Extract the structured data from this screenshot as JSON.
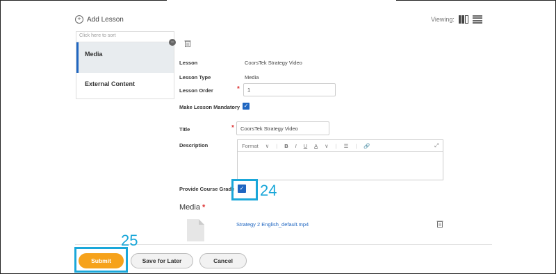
{
  "header": {
    "add_lesson": "Add Lesson",
    "viewing": "Viewing:"
  },
  "sidebar": {
    "sort_hint": "Click here to sort",
    "items": [
      {
        "label": "Media",
        "active": true
      },
      {
        "label": "External Content",
        "active": false
      }
    ]
  },
  "form": {
    "lesson_label": "Lesson",
    "lesson_value": "CoorsTek Strategy Video",
    "lesson_type_label": "Lesson Type",
    "lesson_type_value": "Media",
    "lesson_order_label": "Lesson Order",
    "lesson_order_value": "1",
    "mandatory_label": "Make Lesson Mandatory",
    "title_label": "Title",
    "title_value": "CoorsTek Strategy Video",
    "description_label": "Description",
    "editor_format": "Format",
    "editor_bold": "B",
    "editor_italic": "I",
    "editor_underline": "U",
    "editor_color": "A",
    "grade_label": "Provide Course Grade",
    "media_heading": "Media",
    "media_file": "Strategy 2 English_default.mp4"
  },
  "callouts": {
    "step_24": "24",
    "step_25": "25"
  },
  "footer": {
    "submit": "Submit",
    "save_later": "Save for Later",
    "cancel": "Cancel"
  },
  "colors": {
    "accent": "#1f66c1",
    "submit": "#f6a21b",
    "callout": "#1aa7d9"
  }
}
